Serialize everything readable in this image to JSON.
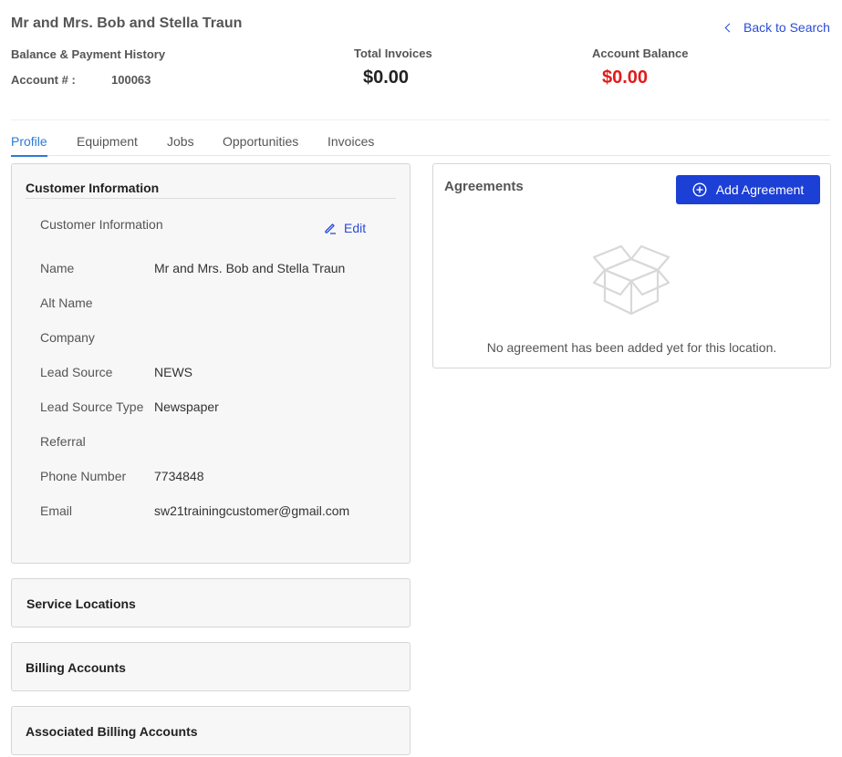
{
  "header": {
    "customer_name": "Mr and Mrs. Bob and Stella Traun",
    "back_label": "Back to Search",
    "balance_title": "Balance & Payment History",
    "account_label": "Account # :",
    "account_number": "100063",
    "total_invoices_label": "Total Invoices",
    "total_invoices_value": "$0.00",
    "account_balance_label": "Account Balance",
    "account_balance_value": "$0.00"
  },
  "tabs": [
    {
      "label": "Profile",
      "active": true
    },
    {
      "label": "Equipment",
      "active": false
    },
    {
      "label": "Jobs",
      "active": false
    },
    {
      "label": "Opportunities",
      "active": false
    },
    {
      "label": "Invoices",
      "active": false
    }
  ],
  "customer_info": {
    "title": "Customer Information",
    "subtitle": "Customer Information",
    "edit_label": "Edit",
    "fields": [
      {
        "label": "Name",
        "value": "Mr and Mrs. Bob and Stella Traun"
      },
      {
        "label": "Alt Name",
        "value": ""
      },
      {
        "label": "Company",
        "value": ""
      },
      {
        "label": "Lead Source",
        "value": "NEWS"
      },
      {
        "label": "Lead Source Type",
        "value": "Newspaper"
      },
      {
        "label": "Referral",
        "value": ""
      },
      {
        "label": "Phone Number",
        "value": "7734848"
      },
      {
        "label": "Email",
        "value": "sw21trainingcustomer@gmail.com"
      }
    ]
  },
  "sections": {
    "service_locations": "Service Locations",
    "billing_accounts": "Billing Accounts",
    "associated_billing_accounts": "Associated Billing Accounts"
  },
  "agreements": {
    "title": "Agreements",
    "add_label": "Add Agreement",
    "empty_message": "No agreement has been added yet for this location.",
    "empty_icon": "open-box-icon"
  },
  "colors": {
    "link": "#2b4bd6",
    "active_tab": "#2b7bd6",
    "primary_button": "#1c3fd6",
    "balance_red": "#e01b1b"
  }
}
